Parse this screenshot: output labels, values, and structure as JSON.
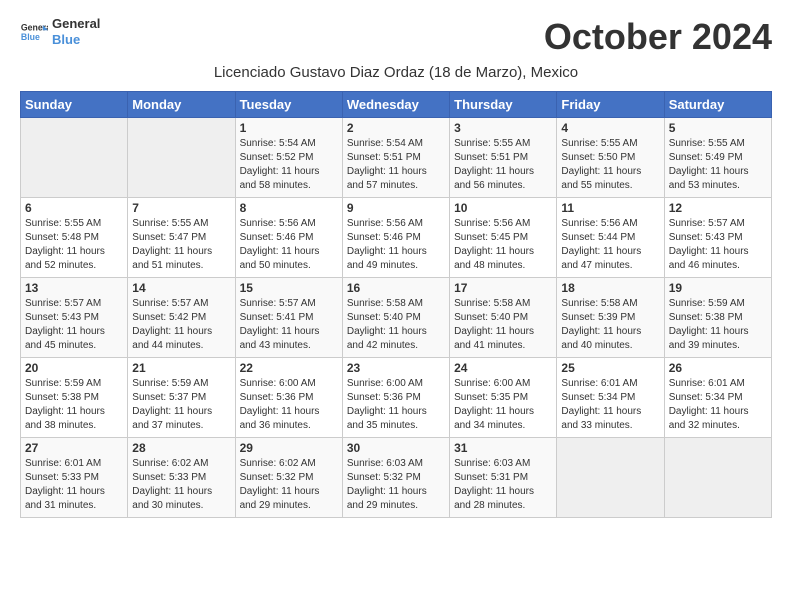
{
  "header": {
    "logo_line1": "General",
    "logo_line2": "Blue",
    "month": "October 2024",
    "subtitle": "Licenciado Gustavo Diaz Ordaz (18 de Marzo), Mexico"
  },
  "weekdays": [
    "Sunday",
    "Monday",
    "Tuesday",
    "Wednesday",
    "Thursday",
    "Friday",
    "Saturday"
  ],
  "days": [
    {
      "num": "",
      "empty": true
    },
    {
      "num": "",
      "empty": true
    },
    {
      "num": "1",
      "sunrise": "5:54 AM",
      "sunset": "5:52 PM",
      "daylight": "11 hours and 58 minutes."
    },
    {
      "num": "2",
      "sunrise": "5:54 AM",
      "sunset": "5:51 PM",
      "daylight": "11 hours and 57 minutes."
    },
    {
      "num": "3",
      "sunrise": "5:55 AM",
      "sunset": "5:51 PM",
      "daylight": "11 hours and 56 minutes."
    },
    {
      "num": "4",
      "sunrise": "5:55 AM",
      "sunset": "5:50 PM",
      "daylight": "11 hours and 55 minutes."
    },
    {
      "num": "5",
      "sunrise": "5:55 AM",
      "sunset": "5:49 PM",
      "daylight": "11 hours and 53 minutes."
    },
    {
      "num": "6",
      "sunrise": "5:55 AM",
      "sunset": "5:48 PM",
      "daylight": "11 hours and 52 minutes."
    },
    {
      "num": "7",
      "sunrise": "5:55 AM",
      "sunset": "5:47 PM",
      "daylight": "11 hours and 51 minutes."
    },
    {
      "num": "8",
      "sunrise": "5:56 AM",
      "sunset": "5:46 PM",
      "daylight": "11 hours and 50 minutes."
    },
    {
      "num": "9",
      "sunrise": "5:56 AM",
      "sunset": "5:46 PM",
      "daylight": "11 hours and 49 minutes."
    },
    {
      "num": "10",
      "sunrise": "5:56 AM",
      "sunset": "5:45 PM",
      "daylight": "11 hours and 48 minutes."
    },
    {
      "num": "11",
      "sunrise": "5:56 AM",
      "sunset": "5:44 PM",
      "daylight": "11 hours and 47 minutes."
    },
    {
      "num": "12",
      "sunrise": "5:57 AM",
      "sunset": "5:43 PM",
      "daylight": "11 hours and 46 minutes."
    },
    {
      "num": "13",
      "sunrise": "5:57 AM",
      "sunset": "5:43 PM",
      "daylight": "11 hours and 45 minutes."
    },
    {
      "num": "14",
      "sunrise": "5:57 AM",
      "sunset": "5:42 PM",
      "daylight": "11 hours and 44 minutes."
    },
    {
      "num": "15",
      "sunrise": "5:57 AM",
      "sunset": "5:41 PM",
      "daylight": "11 hours and 43 minutes."
    },
    {
      "num": "16",
      "sunrise": "5:58 AM",
      "sunset": "5:40 PM",
      "daylight": "11 hours and 42 minutes."
    },
    {
      "num": "17",
      "sunrise": "5:58 AM",
      "sunset": "5:40 PM",
      "daylight": "11 hours and 41 minutes."
    },
    {
      "num": "18",
      "sunrise": "5:58 AM",
      "sunset": "5:39 PM",
      "daylight": "11 hours and 40 minutes."
    },
    {
      "num": "19",
      "sunrise": "5:59 AM",
      "sunset": "5:38 PM",
      "daylight": "11 hours and 39 minutes."
    },
    {
      "num": "20",
      "sunrise": "5:59 AM",
      "sunset": "5:38 PM",
      "daylight": "11 hours and 38 minutes."
    },
    {
      "num": "21",
      "sunrise": "5:59 AM",
      "sunset": "5:37 PM",
      "daylight": "11 hours and 37 minutes."
    },
    {
      "num": "22",
      "sunrise": "6:00 AM",
      "sunset": "5:36 PM",
      "daylight": "11 hours and 36 minutes."
    },
    {
      "num": "23",
      "sunrise": "6:00 AM",
      "sunset": "5:36 PM",
      "daylight": "11 hours and 35 minutes."
    },
    {
      "num": "24",
      "sunrise": "6:00 AM",
      "sunset": "5:35 PM",
      "daylight": "11 hours and 34 minutes."
    },
    {
      "num": "25",
      "sunrise": "6:01 AM",
      "sunset": "5:34 PM",
      "daylight": "11 hours and 33 minutes."
    },
    {
      "num": "26",
      "sunrise": "6:01 AM",
      "sunset": "5:34 PM",
      "daylight": "11 hours and 32 minutes."
    },
    {
      "num": "27",
      "sunrise": "6:01 AM",
      "sunset": "5:33 PM",
      "daylight": "11 hours and 31 minutes."
    },
    {
      "num": "28",
      "sunrise": "6:02 AM",
      "sunset": "5:33 PM",
      "daylight": "11 hours and 30 minutes."
    },
    {
      "num": "29",
      "sunrise": "6:02 AM",
      "sunset": "5:32 PM",
      "daylight": "11 hours and 29 minutes."
    },
    {
      "num": "30",
      "sunrise": "6:03 AM",
      "sunset": "5:32 PM",
      "daylight": "11 hours and 29 minutes."
    },
    {
      "num": "31",
      "sunrise": "6:03 AM",
      "sunset": "5:31 PM",
      "daylight": "11 hours and 28 minutes."
    },
    {
      "num": "",
      "empty": true
    },
    {
      "num": "",
      "empty": true
    }
  ],
  "labels": {
    "sunrise_prefix": "Sunrise: ",
    "sunset_prefix": "Sunset: ",
    "daylight_prefix": "Daylight: "
  }
}
